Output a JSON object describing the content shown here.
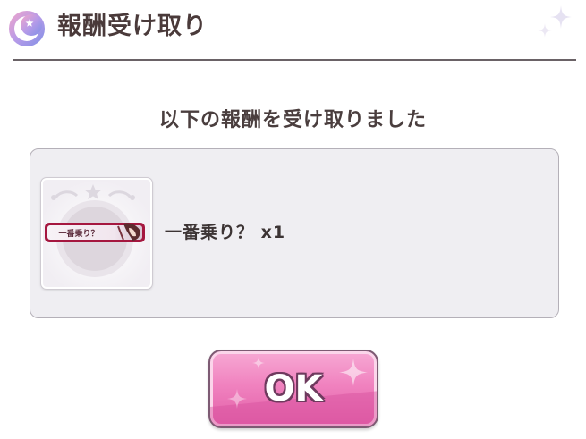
{
  "header": {
    "title": "報酬受け取り",
    "icon": "moon-star-icon",
    "decoration_icon": "sparkle-icon"
  },
  "message": "以下の報酬を受け取りました",
  "rewards": [
    {
      "name": "一番乗り？",
      "quantity": "x1",
      "label": "一番乗り？ x1",
      "icon": "title-badge-icon",
      "badge_text": "一番乗り？"
    }
  ],
  "ok_button": {
    "label": "OK"
  },
  "colors": {
    "accent_pink": "#f082bf",
    "button_border": "#7d5a73",
    "panel_bg": "#efeef2",
    "text_dark": "#4a3a3a"
  }
}
